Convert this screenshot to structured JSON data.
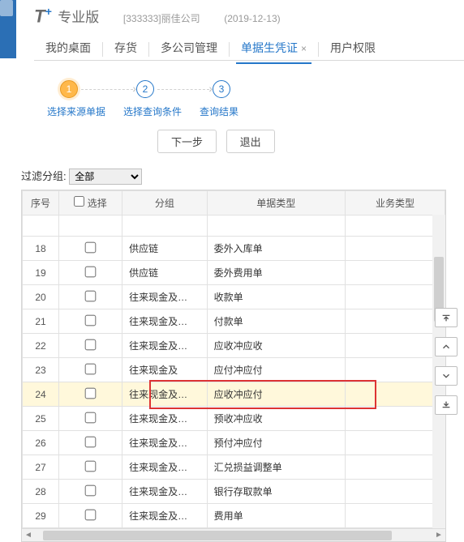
{
  "brand": "T",
  "brand_plus": "+",
  "edition": "专业版",
  "company": "[333333]丽佳公司",
  "date": "(2019-12-13)",
  "tabs": [
    {
      "label": "我的桌面"
    },
    {
      "label": "存货"
    },
    {
      "label": "多公司管理"
    },
    {
      "label": "单据生凭证",
      "active": true,
      "closable": true
    },
    {
      "label": "用户权限"
    }
  ],
  "wizard": {
    "steps": [
      "1",
      "2",
      "3"
    ],
    "labels": [
      "选择来源单据",
      "选择查询条件",
      "查询结果"
    ],
    "buttons": {
      "next": "下一步",
      "exit": "退出"
    }
  },
  "filter": {
    "label": "过滤分组:",
    "value": "全部"
  },
  "columns": {
    "seq": "序号",
    "select": "选择",
    "group": "分组",
    "type": "单据类型",
    "biz": "业务类型"
  },
  "rows": [
    {
      "seq": "18",
      "group": "供应链",
      "type": "委外入库单"
    },
    {
      "seq": "19",
      "group": "供应链",
      "type": "委外费用单"
    },
    {
      "seq": "20",
      "group": "往来现金及…",
      "type": "收款单"
    },
    {
      "seq": "21",
      "group": "往来现金及…",
      "type": "付款单"
    },
    {
      "seq": "22",
      "group": "往来现金及…",
      "type": "应收冲应收"
    },
    {
      "seq": "23",
      "group": "往来现金及",
      "type": "应付冲应付"
    },
    {
      "seq": "24",
      "group": "往来现金及…",
      "type": "应收冲应付",
      "hl": true
    },
    {
      "seq": "25",
      "group": "往来现金及…",
      "type": "预收冲应收"
    },
    {
      "seq": "26",
      "group": "往来现金及…",
      "type": "预付冲应付"
    },
    {
      "seq": "27",
      "group": "往来现金及…",
      "type": "汇兑损益调整单"
    },
    {
      "seq": "28",
      "group": "往来现金及…",
      "type": "银行存取款单"
    },
    {
      "seq": "29",
      "group": "往来现金及…",
      "type": "费用单"
    }
  ]
}
